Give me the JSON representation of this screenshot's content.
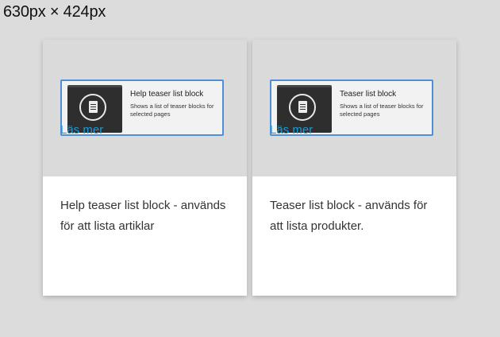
{
  "dimension_label": "630px × 424px",
  "colors": {
    "background": "#dcdcdc",
    "card": "#ffffff",
    "preview_border": "#4d90d6",
    "link": "#1a9ad6"
  },
  "cards": [
    {
      "preview_title": "Help teaser list block",
      "preview_description": "Shows a list of teaser blocks for selected pages",
      "preview_icon": "document-icon",
      "text": "Help teaser list block - används för att lista artiklar",
      "link_label": "Läs mer"
    },
    {
      "preview_title": "Teaser list block",
      "preview_description": "Shows a list of teaser blocks for selected pages",
      "preview_icon": "document-icon",
      "text": "Teaser list block - används för att lista produkter.",
      "link_label": "Läs mer"
    }
  ]
}
